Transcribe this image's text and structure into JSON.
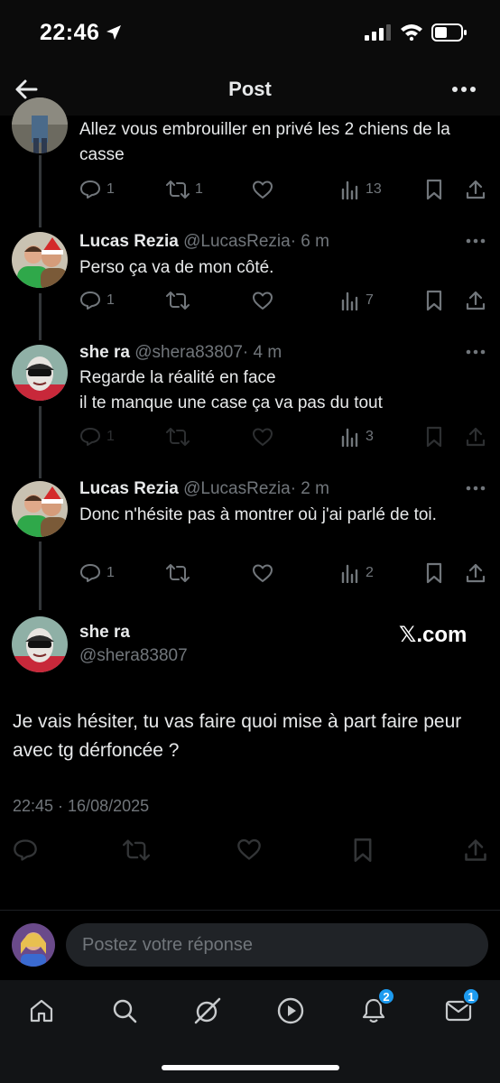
{
  "status_bar": {
    "time": "22:46"
  },
  "header": {
    "title": "Post",
    "back_icon": "back-arrow-icon",
    "more_icon": "more-horizontal-icon"
  },
  "thread": [
    {
      "id": "t0",
      "text": "Allez vous embrouiller en privé les 2 chiens de la casse",
      "replies": "1",
      "reposts": "1",
      "likes": "",
      "views": "13"
    },
    {
      "id": "t1",
      "name": "Lucas Rezia",
      "handle": "@LucasRezia",
      "time": "· 6 m",
      "text": "Perso ça va de mon côté.",
      "replies": "1",
      "reposts": "",
      "likes": "",
      "views": "7"
    },
    {
      "id": "t2",
      "name": "she ra",
      "handle": "@shera83807",
      "time": "· 4 m",
      "text_line1": "Regarde la réalité en face",
      "text_line2": "il te manque une case ça va pas du tout",
      "replies": "1",
      "reposts": "",
      "likes": "",
      "views": "3"
    },
    {
      "id": "t3",
      "name": "Lucas Rezia",
      "handle": "@LucasRezia",
      "time": "· 2 m",
      "text": "Donc n'hésite pas à montrer où j'ai parlé de toi.",
      "replies": "1",
      "reposts": "",
      "likes": "",
      "views": "2"
    }
  ],
  "main_post": {
    "name": "she ra",
    "handle": "@shera83807",
    "watermark": "𝕏.com",
    "text": "Je vais hésiter, tu vas faire quoi mise à part faire peur avec tg dérfoncée ?",
    "timestamp": "22:45 · 16/08/2025"
  },
  "reply_bar": {
    "placeholder": "Postez votre réponse"
  },
  "bottom_nav": {
    "items": [
      "home-icon",
      "search-icon",
      "grok-icon",
      "video-icon",
      "notifications-icon",
      "messages-icon"
    ],
    "notifications_badge": "2",
    "messages_badge": "1"
  },
  "colors": {
    "accent": "#1d9bf0",
    "text": "#e7e9ea",
    "muted": "#71767b",
    "background": "#000000"
  }
}
